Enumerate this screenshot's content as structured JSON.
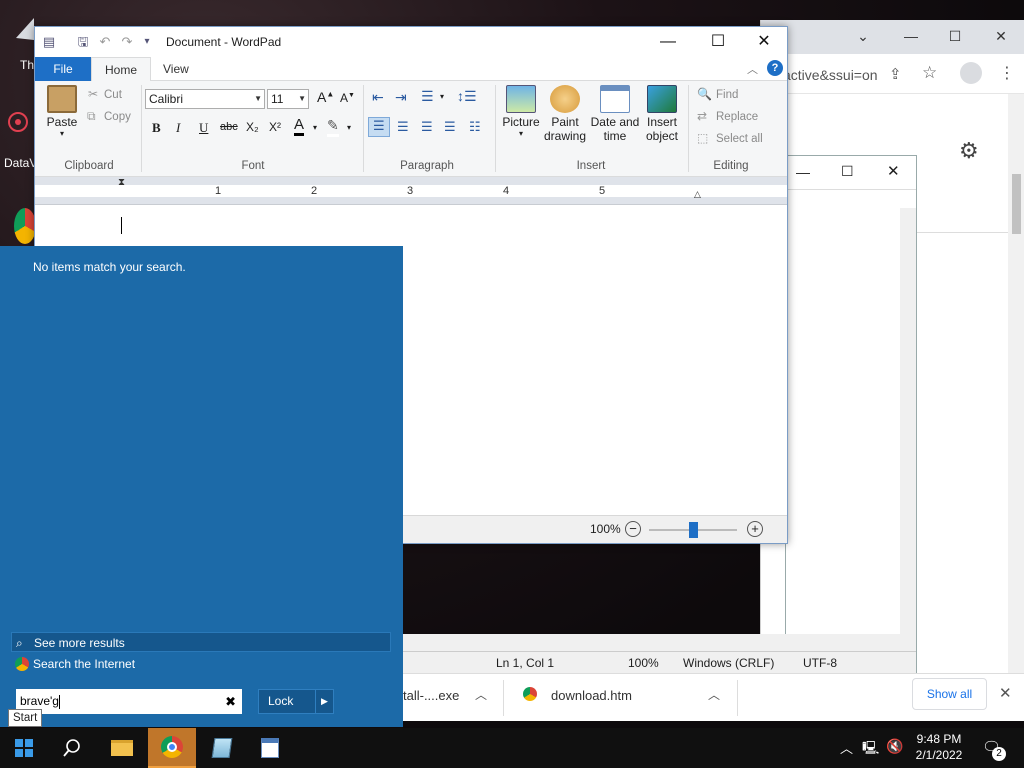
{
  "desktop": {
    "icons": [
      {
        "label": "Th"
      },
      {
        "label": "DataV"
      }
    ]
  },
  "chrome": {
    "url_fragment": "active&ssui=on"
  },
  "wordpad": {
    "title": "Document - WordPad",
    "tabs": {
      "file": "File",
      "home": "Home",
      "view": "View"
    },
    "clipboard": {
      "paste": "Paste",
      "cut": "Cut",
      "copy": "Copy",
      "label": "Clipboard"
    },
    "font": {
      "family": "Calibri",
      "size": "11",
      "label": "Font",
      "bold": "B",
      "italic": "I",
      "underline": "U",
      "strike": "abc",
      "sub": "X₂",
      "sup": "X²",
      "color": "A"
    },
    "paragraph": {
      "label": "Paragraph"
    },
    "insert": {
      "picture": "Picture",
      "paint1": "Paint",
      "paint2": "drawing",
      "date1": "Date and",
      "date2": "time",
      "object1": "Insert",
      "object2": "object",
      "label": "Insert"
    },
    "editing": {
      "find": "Find",
      "replace": "Replace",
      "select_all": "Select all",
      "label": "Editing"
    },
    "ruler": [
      "1",
      "2",
      "3",
      "4",
      "5"
    ],
    "zoom": "100%",
    "zoom_level": 0.5
  },
  "notepad": {
    "status": {
      "position": "Ln 1, Col 1",
      "zoom": "100%",
      "eol": "Windows (CRLF)",
      "encoding": "UTF-8"
    }
  },
  "start": {
    "no_items": "No items match your search.",
    "see_more": "See more results",
    "search_internet": "Search the Internet",
    "query": "brave'g",
    "lock": "Lock",
    "tooltip": "Start"
  },
  "downloads": {
    "item1": "tall-....exe",
    "item2": "download.htm",
    "show_all": "Show all"
  },
  "taskbar": {
    "time": "9:48 PM",
    "date": "2/1/2022",
    "notif_count": "2"
  }
}
